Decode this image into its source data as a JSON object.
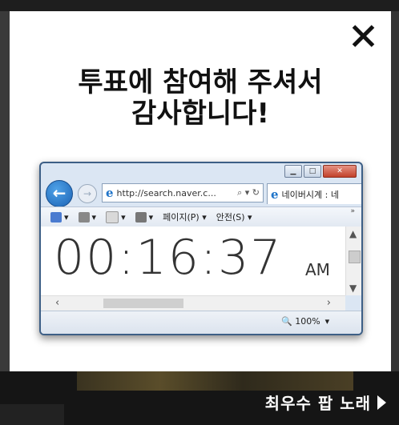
{
  "modal": {
    "title_line1": "투표에 참여해 주셔서",
    "title_line2": "감사합니다!",
    "close_glyph": "✕"
  },
  "browser": {
    "address": "http://search.naver.c...",
    "address_tools": "⌕ ▾ ↻",
    "tab_title": "네이버시계 : 네",
    "commands": [
      {
        "icon": "home-icon",
        "label": "▾"
      },
      {
        "icon": "rss-icon",
        "label": "▾"
      },
      {
        "icon": "mail-icon",
        "label": "▾"
      },
      {
        "icon": "print-icon",
        "label": "▾"
      },
      {
        "icon": "",
        "label": "페이지(P) ▾"
      },
      {
        "icon": "",
        "label": "안전(S) ▾"
      }
    ],
    "clock_time": "00:16:37",
    "clock_ampm": "AM",
    "zoom": "🔍 100%",
    "zoom_arrow": "▾"
  },
  "background": {
    "link_label": "최우수 팝 노래"
  }
}
